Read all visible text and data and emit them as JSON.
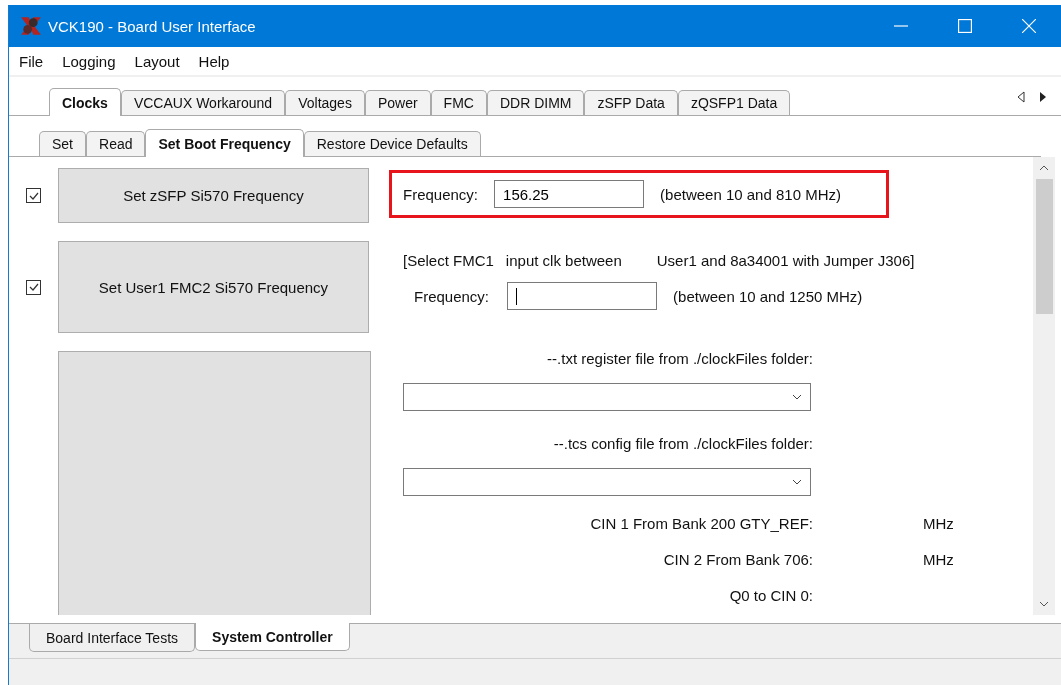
{
  "window": {
    "title": "VCK190 - Board User Interface"
  },
  "menu": [
    "File",
    "Logging",
    "Layout",
    "Help"
  ],
  "tabs": [
    {
      "label": "Clocks",
      "selected": true
    },
    {
      "label": "VCCAUX Workaround",
      "selected": false
    },
    {
      "label": "Voltages",
      "selected": false
    },
    {
      "label": "Power",
      "selected": false
    },
    {
      "label": "FMC",
      "selected": false
    },
    {
      "label": "DDR DIMM",
      "selected": false
    },
    {
      "label": "zSFP Data",
      "selected": false
    },
    {
      "label": "zQSFP1 Data",
      "selected": false
    }
  ],
  "subtabs": [
    {
      "label": "Set",
      "selected": false
    },
    {
      "label": "Read",
      "selected": false
    },
    {
      "label": "Set Boot Frequency",
      "selected": true
    },
    {
      "label": "Restore Device Defaults",
      "selected": false
    }
  ],
  "zsfp": {
    "checked": true,
    "button": "Set zSFP Si570 Frequency",
    "label": "Frequency:",
    "value": "156.25",
    "range": "(between 10 and 810 MHz)",
    "highlighted": true
  },
  "user1": {
    "checked": true,
    "button": "Set User1 FMC2 Si570 Frequency",
    "note": [
      "[Select FMC1",
      "input clk between",
      "User1 and 8a34001 with Jumper J306]"
    ],
    "label": "Frequency:",
    "range": "(between 10 and 1250 MHz)"
  },
  "files": [
    {
      "label": "--.txt register file from ./clockFiles folder:"
    },
    {
      "label": "--.tcs config file from ./clockFiles folder:"
    }
  ],
  "readings": [
    {
      "label": "CIN 1 From Bank 200 GTY_REF:",
      "unit": "MHz"
    },
    {
      "label": "CIN 2 From Bank 706:",
      "unit": "MHz"
    },
    {
      "label": "Q0 to CIN 0:"
    }
  ],
  "bottom_tabs": [
    {
      "label": "Board Interface Tests",
      "selected": false
    },
    {
      "label": "System Controller",
      "selected": true
    }
  ]
}
